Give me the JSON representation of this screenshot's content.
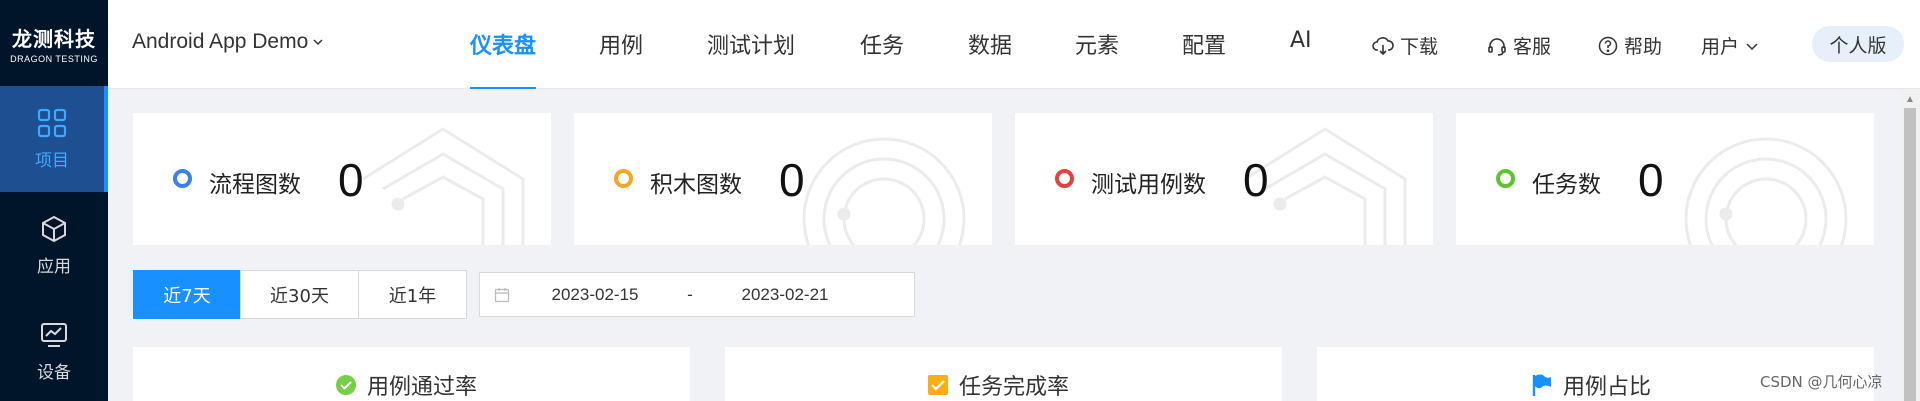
{
  "sidebar": {
    "logo_cn": "龙测科技",
    "logo_en": "DRAGON TESTING",
    "items": [
      {
        "label": "项目",
        "icon": "grid-icon",
        "active": true
      },
      {
        "label": "应用",
        "icon": "cube-icon",
        "active": false
      },
      {
        "label": "设备",
        "icon": "monitor-icon",
        "active": false
      }
    ]
  },
  "header": {
    "app_name": "Android App Demo",
    "tabs": [
      {
        "label": "仪表盘",
        "active": true
      },
      {
        "label": "用例"
      },
      {
        "label": "测试计划"
      },
      {
        "label": "任务"
      },
      {
        "label": "数据"
      },
      {
        "label": "元素"
      },
      {
        "label": "配置"
      },
      {
        "label": "AI"
      }
    ],
    "actions": {
      "download": "下载",
      "support": "客服",
      "help": "帮助",
      "user": "用户"
    },
    "edition": "个人版"
  },
  "stats": [
    {
      "label": "流程图数",
      "value": "0",
      "color": "#3b7ff0"
    },
    {
      "label": "积木图数",
      "value": "0",
      "color": "#f5a623"
    },
    {
      "label": "测试用例数",
      "value": "0",
      "color": "#e83e3e"
    },
    {
      "label": "任务数",
      "value": "0",
      "color": "#5ec42d"
    }
  ],
  "range": {
    "options": [
      "近7天",
      "近30天",
      "近1年"
    ],
    "active_index": 0,
    "start_date": "2023-02-15",
    "separator": "-",
    "end_date": "2023-02-21"
  },
  "panels": [
    {
      "title": "用例通过率",
      "icon": "check-circle-icon",
      "color": "#52c41a"
    },
    {
      "title": "任务完成率",
      "icon": "checkbox-icon",
      "color": "#faad14"
    },
    {
      "title": "用例占比",
      "icon": "flag-icon",
      "color": "#1890ff"
    }
  ],
  "watermark_text": "CSDN @几何心凉",
  "colors": {
    "accent": "#1890ff",
    "sidebar_bg": "#001529",
    "sidebar_active": "#1d4f91"
  }
}
